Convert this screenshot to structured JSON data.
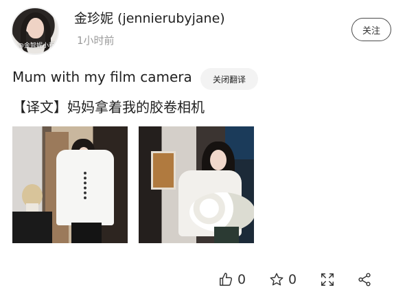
{
  "author": {
    "name": "金珍妮 (jennierubyjane)",
    "time": "1小时前",
    "avatar_watermark": "@金智妮小程序"
  },
  "follow_button": {
    "label": "关注"
  },
  "post": {
    "text": "Mum with my film camera",
    "translate_toggle_label": "关闭翻译",
    "translation": "【译文】妈妈拿着我的胶卷相机"
  },
  "images": [
    {
      "name": "photo-white-shirt-standing"
    },
    {
      "name": "photo-flowers-bouquet"
    }
  ],
  "actions": {
    "like_count": "0",
    "favorite_count": "0"
  },
  "icons": [
    "thumbs-up-icon",
    "star-icon",
    "expand-icon",
    "share-icon"
  ],
  "colors": {
    "text": "#1f1f1f",
    "muted": "#9a9a9a",
    "chip_bg": "#f3f3f3"
  }
}
